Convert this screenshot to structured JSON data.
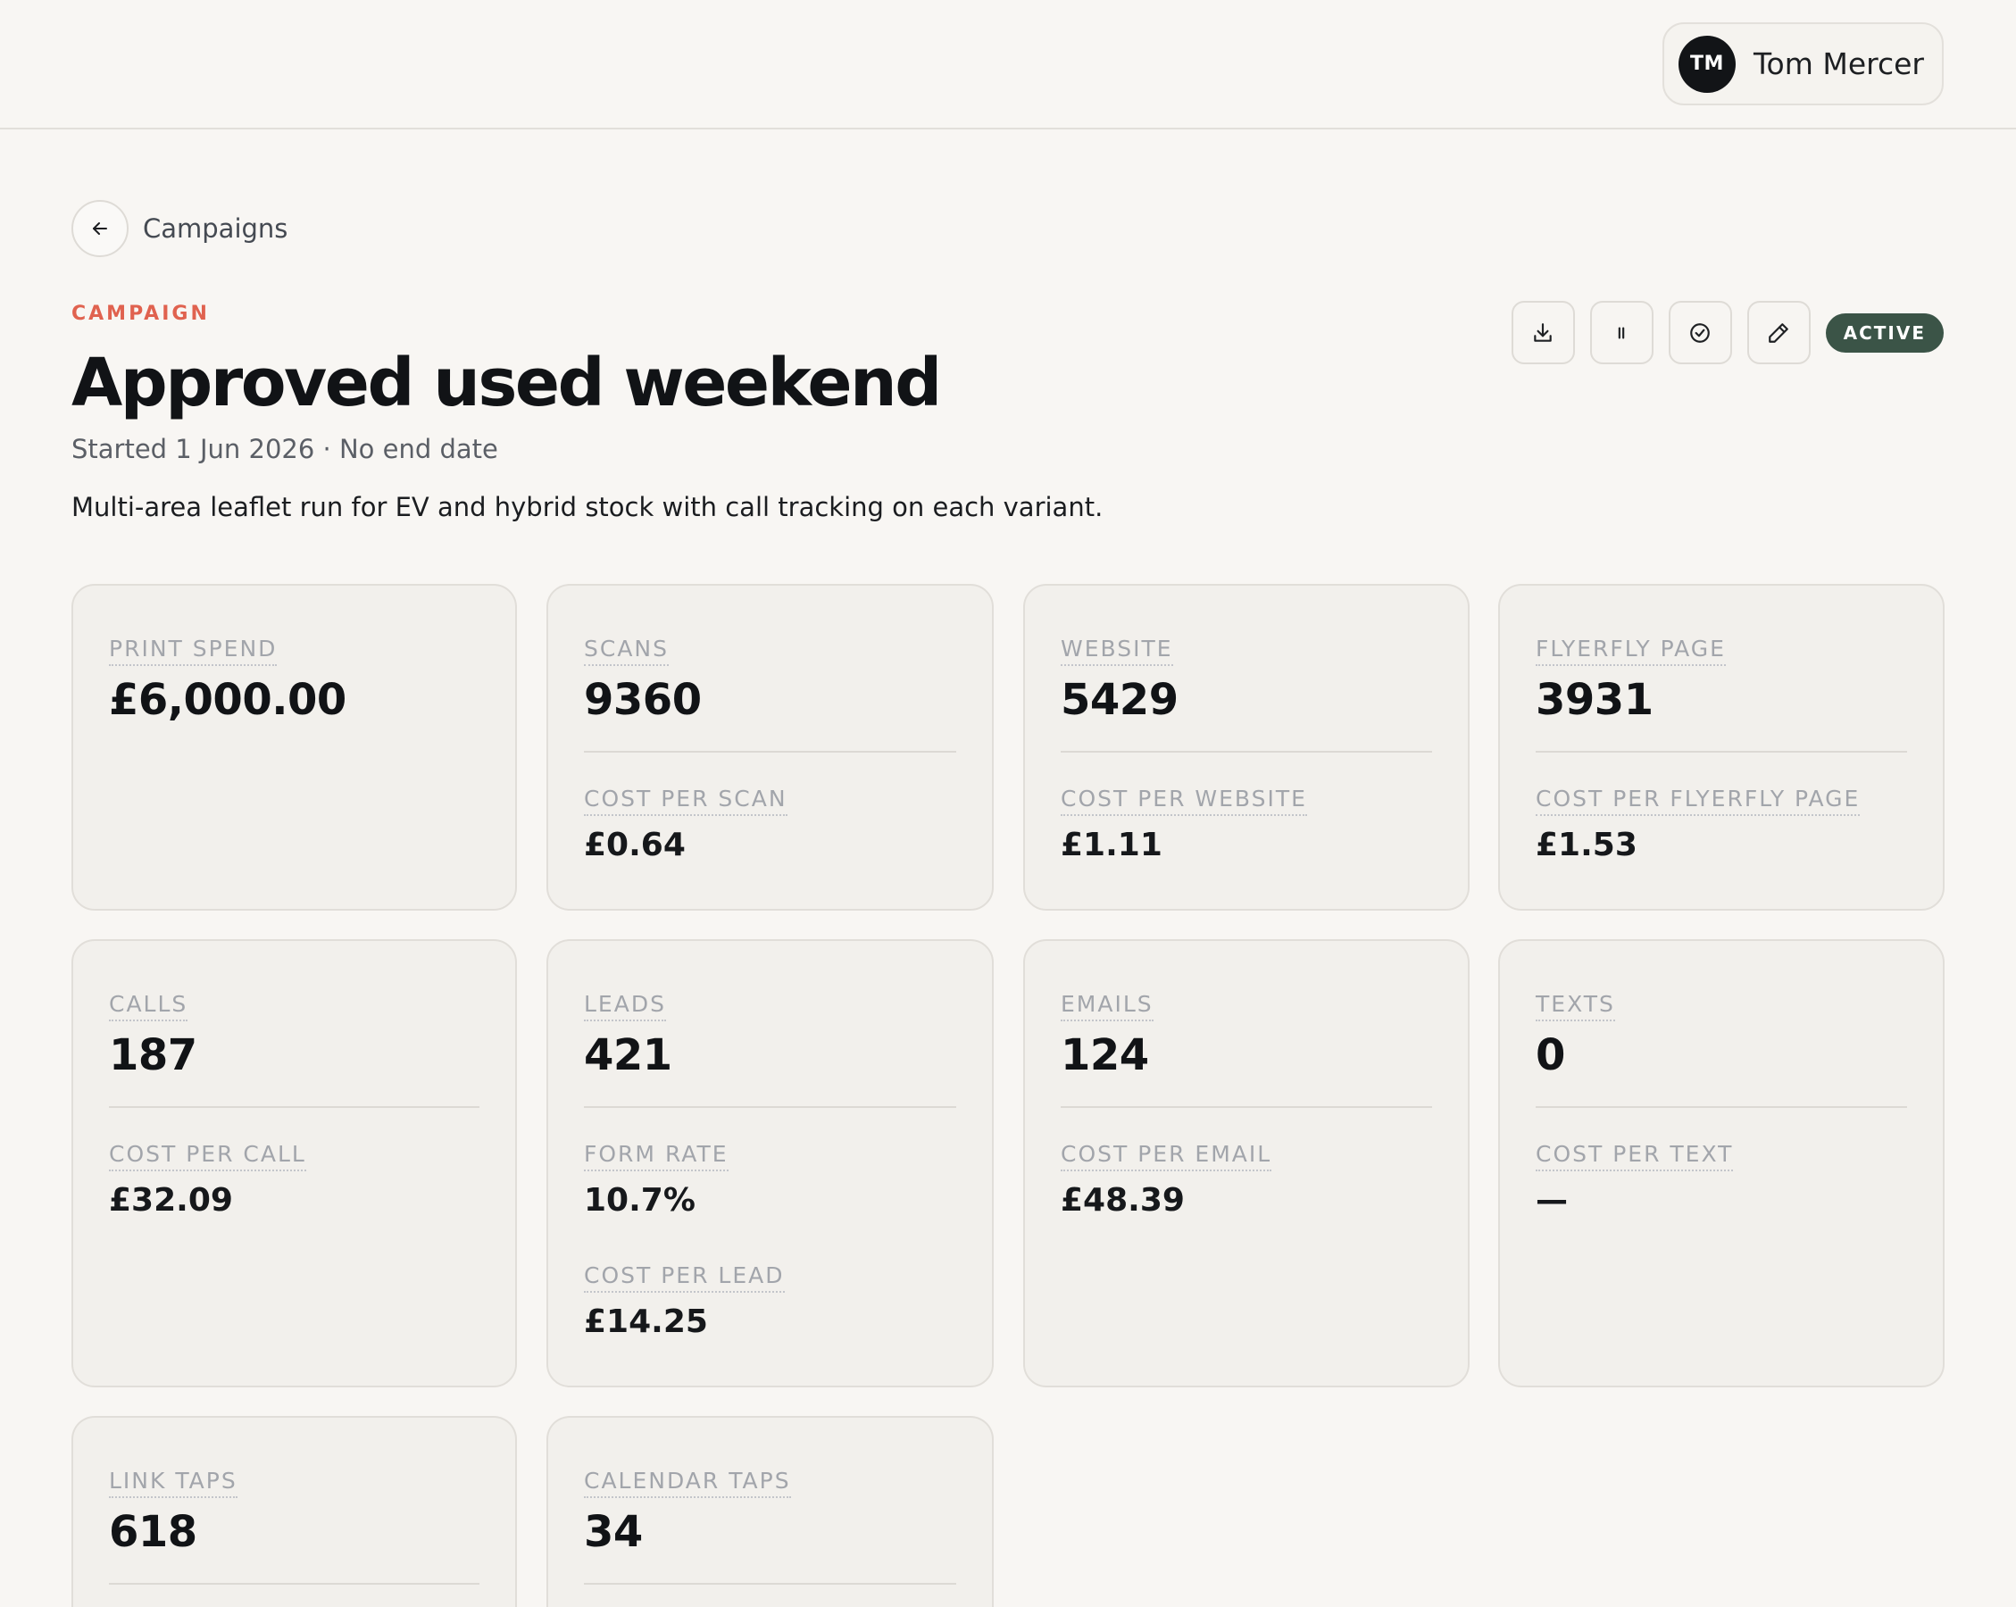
{
  "user": {
    "initials": "TM",
    "name": "Tom Mercer"
  },
  "nav": {
    "back_label": "Campaigns"
  },
  "campaign": {
    "eyebrow": "CAMPAIGN",
    "title": "Approved used weekend",
    "meta": "Started 1 Jun 2026 · No end date",
    "description": "Multi-area leaflet run for EV and hybrid stock with call tracking on each variant.",
    "status": "ACTIVE"
  },
  "actions": [
    {
      "icon": "download-icon"
    },
    {
      "icon": "pause-icon"
    },
    {
      "icon": "check-circle-icon"
    },
    {
      "icon": "edit-icon"
    }
  ],
  "stats": {
    "print_spend": {
      "label": "PRINT SPEND",
      "value": "£6,000.00"
    },
    "scans": {
      "label": "SCANS",
      "value": "9360",
      "sub_label": "COST PER SCAN",
      "sub_value": "£0.64"
    },
    "website": {
      "label": "WEBSITE",
      "value": "5429",
      "sub_label": "COST PER WEBSITE",
      "sub_value": "£1.11"
    },
    "flyerfly_page": {
      "label": "FLYERFLY PAGE",
      "value": "3931",
      "sub_label": "COST PER FLYERFLY PAGE",
      "sub_value": "£1.53"
    },
    "calls": {
      "label": "CALLS",
      "value": "187",
      "sub_label": "COST PER CALL",
      "sub_value": "£32.09"
    },
    "leads": {
      "label": "LEADS",
      "value": "421",
      "sub_label": "FORM RATE",
      "sub_value": "10.7%",
      "sub_label_2": "COST PER LEAD",
      "sub_value_2": "£14.25"
    },
    "emails": {
      "label": "EMAILS",
      "value": "124",
      "sub_label": "COST PER EMAIL",
      "sub_value": "£48.39"
    },
    "texts": {
      "label": "TEXTS",
      "value": "0",
      "sub_label": "COST PER TEXT",
      "sub_value": "—"
    },
    "link_taps": {
      "label": "LINK TAPS",
      "value": "618"
    },
    "calendar_taps": {
      "label": "CALENDAR TAPS",
      "value": "34"
    }
  }
}
